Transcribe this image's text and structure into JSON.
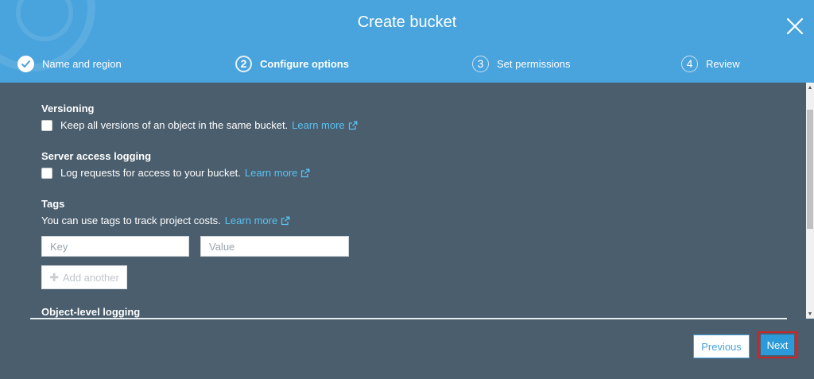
{
  "header": {
    "title": "Create bucket",
    "close_icon": "close-icon",
    "steps": [
      {
        "number": "",
        "label": "Name and region",
        "state": "done"
      },
      {
        "number": "2",
        "label": "Configure options",
        "state": "active"
      },
      {
        "number": "3",
        "label": "Set permissions",
        "state": "pending"
      },
      {
        "number": "4",
        "label": "Review",
        "state": "pending"
      }
    ]
  },
  "versioning": {
    "title": "Versioning",
    "text": "Keep all versions of an object in the same bucket.",
    "link": "Learn more"
  },
  "logging": {
    "title": "Server access logging",
    "text": "Log requests for access to your bucket.",
    "link": "Learn more"
  },
  "tags": {
    "title": "Tags",
    "text": "You can use tags to track project costs.",
    "link": "Learn more",
    "key_placeholder": "Key",
    "value_placeholder": "Value",
    "add_label": "Add another"
  },
  "object_logging": {
    "title": "Object-level logging"
  },
  "footer": {
    "previous_label": "Previous",
    "next_label": "Next"
  },
  "colors": {
    "header": "#49a3dc",
    "body": "#4a5e6d",
    "link": "#5bc2f4",
    "next": "#2c9ad8",
    "highlight": "#c9262b"
  }
}
